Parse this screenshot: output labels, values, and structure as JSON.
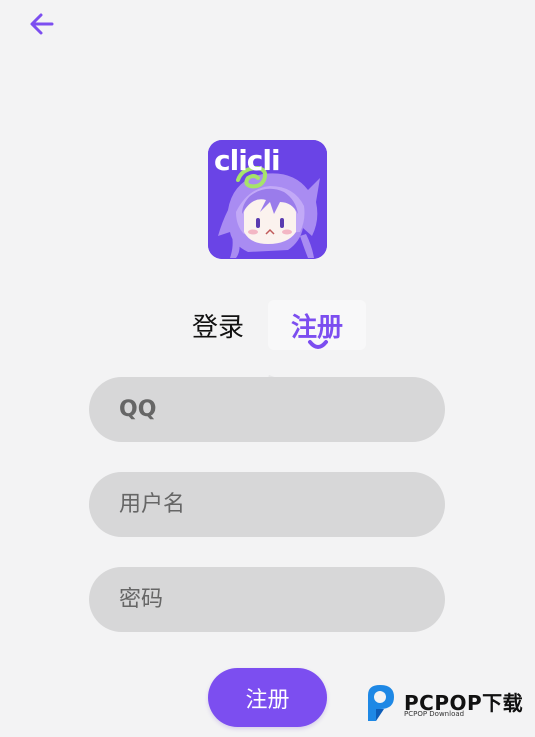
{
  "header": {
    "back_icon": "arrow-left-icon",
    "accent_color": "#7c4ef0"
  },
  "logo": {
    "text": "clicli"
  },
  "tabs": [
    {
      "label": "登录",
      "active": false
    },
    {
      "label": "注册",
      "active": true
    }
  ],
  "form": {
    "qq_placeholder": "QQ",
    "username_placeholder": "用户名",
    "password_placeholder": "密码",
    "submit_label": "注册"
  },
  "watermark": {
    "brand": "PCPOP下载",
    "sub": "PCPOP Download"
  }
}
